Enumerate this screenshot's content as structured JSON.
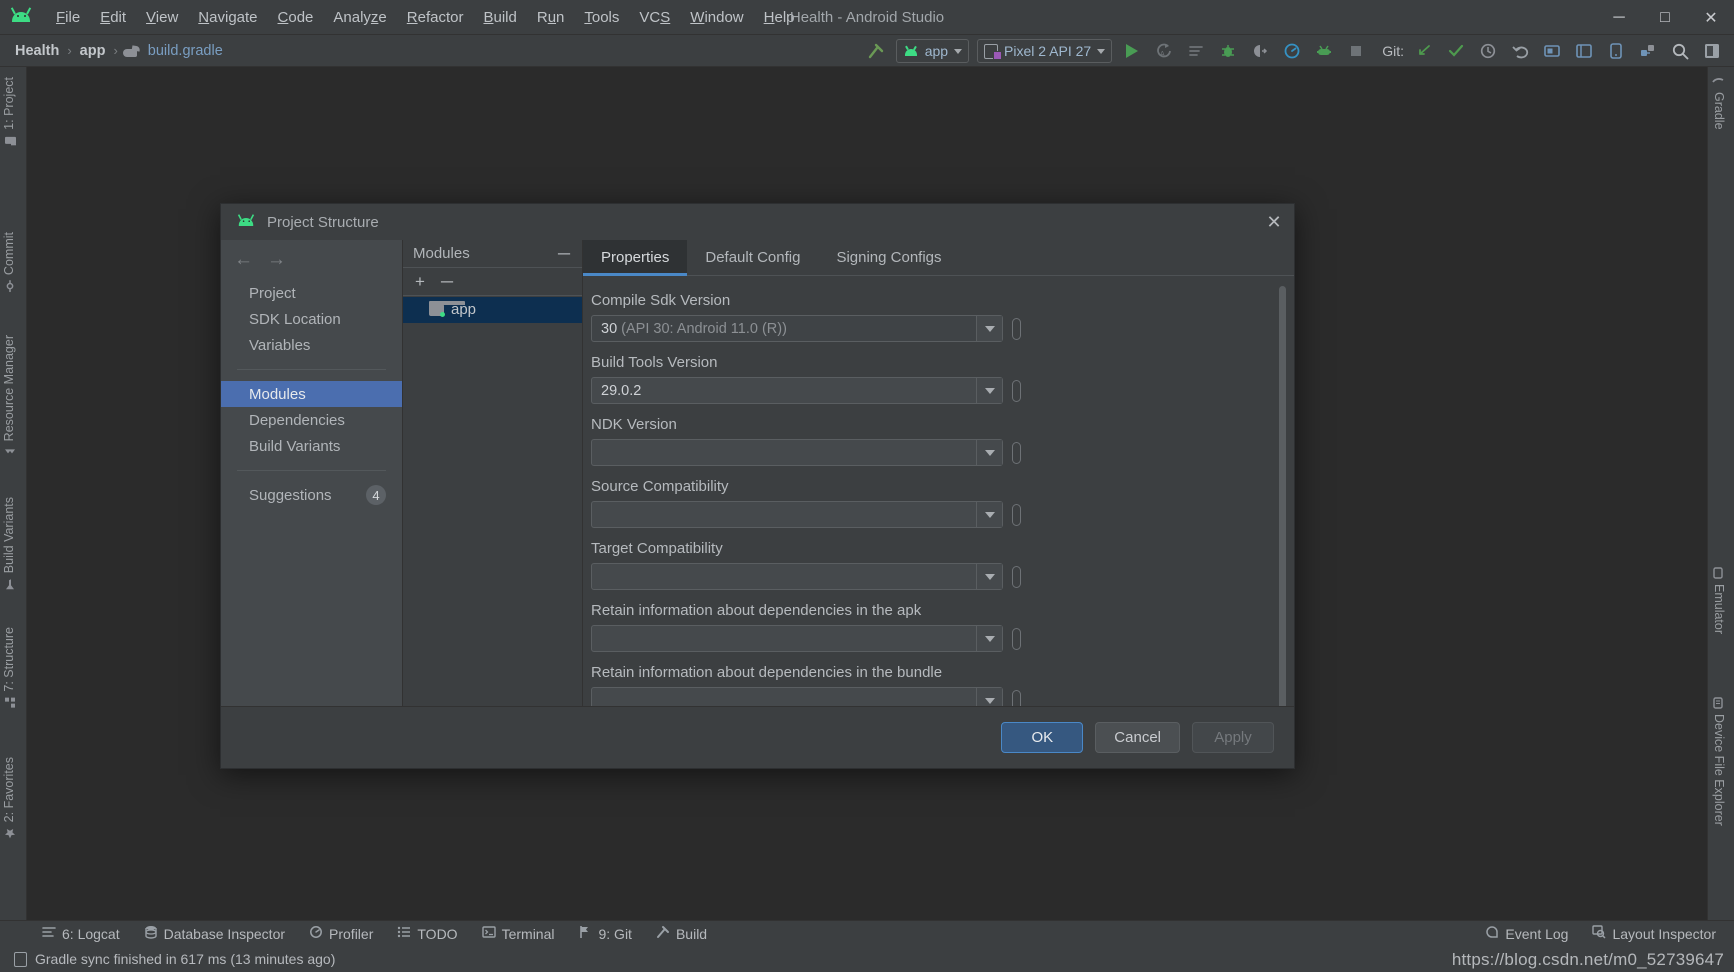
{
  "window": {
    "title": "Health - Android Studio",
    "menu": [
      {
        "label": "File",
        "mnemonic": "F"
      },
      {
        "label": "Edit",
        "mnemonic": "E"
      },
      {
        "label": "View",
        "mnemonic": "V"
      },
      {
        "label": "Navigate",
        "mnemonic": "N"
      },
      {
        "label": "Code",
        "mnemonic": "C"
      },
      {
        "label": "Analyze",
        "mnemonic": "z"
      },
      {
        "label": "Refactor",
        "mnemonic": "R"
      },
      {
        "label": "Build",
        "mnemonic": "B"
      },
      {
        "label": "Run",
        "mnemonic": "u"
      },
      {
        "label": "Tools",
        "mnemonic": "T"
      },
      {
        "label": "VCS",
        "mnemonic": "S"
      },
      {
        "label": "Window",
        "mnemonic": "W"
      },
      {
        "label": "Help",
        "mnemonic": "H"
      }
    ],
    "controls": {
      "minimize": "─",
      "maximize": "□",
      "close": "✕"
    }
  },
  "navbar": {
    "breadcrumbs": [
      {
        "label": "Health"
      },
      {
        "label": "app"
      },
      {
        "label": "build.gradle"
      }
    ],
    "separator": "›",
    "run_config": "app",
    "device": "Pixel 2 API 27",
    "git_label": "Git:"
  },
  "left_tool_windows": [
    {
      "label": "1: Project",
      "mnemonic": "1"
    },
    {
      "label": "Commit"
    },
    {
      "label": "Resource Manager"
    },
    {
      "label": "Build Variants"
    },
    {
      "label": "7: Structure",
      "mnemonic": "7"
    },
    {
      "label": "2: Favorites",
      "mnemonic": "2"
    }
  ],
  "right_tool_windows": [
    {
      "label": "Gradle"
    },
    {
      "label": "Emulator"
    },
    {
      "label": "Device File Explorer"
    }
  ],
  "dialog": {
    "title": "Project Structure",
    "close_label": "✕",
    "nav": {
      "back": "←",
      "forward": "→",
      "items": [
        {
          "label": "Project",
          "selected": false
        },
        {
          "label": "SDK Location",
          "selected": false
        },
        {
          "label": "Variables",
          "selected": false
        },
        {
          "label": "Modules",
          "selected": true
        },
        {
          "label": "Dependencies",
          "selected": false
        },
        {
          "label": "Build Variants",
          "selected": false
        }
      ],
      "suggestions": {
        "label": "Suggestions",
        "count": "4"
      }
    },
    "modules": {
      "header": "Modules",
      "collapse_label": "─",
      "add_label": "+",
      "remove_label": "─",
      "items": [
        {
          "label": "app",
          "selected": true
        }
      ]
    },
    "tabs": [
      {
        "label": "Properties",
        "active": true
      },
      {
        "label": "Default Config",
        "active": false
      },
      {
        "label": "Signing Configs",
        "active": false
      }
    ],
    "fields": [
      {
        "label": "Compile Sdk Version",
        "value": "30",
        "value_suffix": " (API 30: Android 11.0 (R))",
        "dim": true
      },
      {
        "label": "Build Tools Version",
        "value": "29.0.2",
        "value_suffix": "",
        "dim": false
      },
      {
        "label": "NDK Version",
        "value": "",
        "value_suffix": "",
        "dim": false
      },
      {
        "label": "Source Compatibility",
        "value": "",
        "value_suffix": "",
        "dim": false
      },
      {
        "label": "Target Compatibility",
        "value": "",
        "value_suffix": "",
        "dim": false
      },
      {
        "label": "Retain information about dependencies in the apk",
        "value": "",
        "value_suffix": "",
        "dim": false
      },
      {
        "label": "Retain information about dependencies in the bundle",
        "value": "",
        "value_suffix": "",
        "dim": false
      }
    ],
    "buttons": {
      "ok": "OK",
      "cancel": "Cancel",
      "apply": "Apply"
    }
  },
  "bottom_bar": {
    "items": [
      {
        "label": "6: Logcat",
        "mnemonic": "6",
        "icon": "logcat-icon"
      },
      {
        "label": "Database Inspector",
        "icon": "database-icon"
      },
      {
        "label": "Profiler",
        "icon": "profiler-icon"
      },
      {
        "label": "TODO",
        "icon": "todo-icon"
      },
      {
        "label": "Terminal",
        "icon": "terminal-icon"
      },
      {
        "label": "9: Git",
        "mnemonic": "9",
        "icon": "git-icon"
      },
      {
        "label": "Build",
        "icon": "build-icon"
      }
    ],
    "right_items": [
      {
        "label": "Event Log",
        "icon": "event-log-icon"
      },
      {
        "label": "Layout Inspector",
        "icon": "layout-inspector-icon"
      }
    ]
  },
  "status_bar": {
    "message": "Gradle sync finished in 617 ms (13 minutes ago)"
  },
  "watermark": {
    "text": "https://blog.csdn.net/m0_52739647"
  },
  "colors": {
    "accent_blue": "#4a88c7",
    "selection_blue": "#4b6eaf",
    "tree_selection": "#0d2f50",
    "android_green": "#3ddc84",
    "panel_bg": "#3c3f41",
    "editor_bg": "#2b2b2b"
  }
}
